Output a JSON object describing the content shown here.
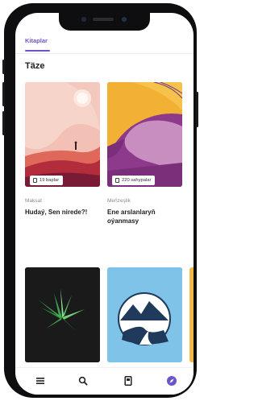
{
  "tabs": {
    "active_label": "Kitaplar"
  },
  "section": {
    "title": "Täze"
  },
  "books": [
    {
      "category": "Maksat",
      "title_line1": "Hudaý, Sen nirede?!",
      "title_line2": "",
      "badge": "19 baplar"
    },
    {
      "category": "Meňzeşlik",
      "title_line1": "Ene arslanlaryň",
      "title_line2": "oýanmasy",
      "badge": "220 sahypalar"
    }
  ],
  "nav": {
    "active": "compass",
    "accent": "#6d55c9"
  }
}
